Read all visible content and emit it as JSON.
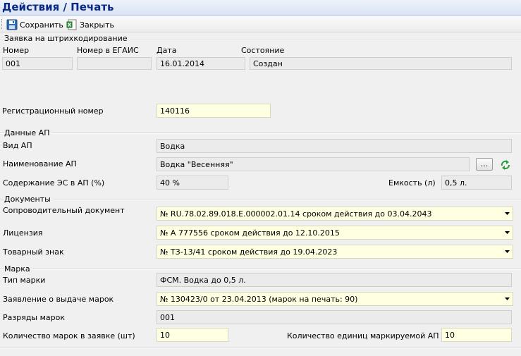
{
  "window": {
    "title": "Действия / Печать"
  },
  "toolbar": {
    "save_label": "Сохранить",
    "close_label": "Закрыть"
  },
  "barcode_request": {
    "section_title": "Заявка на штрихкодирование",
    "number_label": "Номер",
    "number_value": "001",
    "egais_number_label": "Номер в ЕГАИС",
    "egais_number_value": "",
    "date_label": "Дата",
    "date_value": "16.01.2014",
    "status_label": "Состояние",
    "status_value": "Создан",
    "reg_number_label": "Регистрационный номер",
    "reg_number_value": "140116"
  },
  "ap_data": {
    "section_title": "Данные АП",
    "type_label": "Вид АП",
    "type_value": "Водка",
    "name_label": "Наименование АП",
    "name_value": "Водка \"Весенняя\"",
    "browse_label": "...",
    "alcohol_label": "Содержание ЭС в АП (%)",
    "alcohol_value": "40 %",
    "volume_label": "Емкость (л)",
    "volume_value": "0,5 л."
  },
  "documents": {
    "section_title": "Документы",
    "accompanying_label": "Сопроводительный документ",
    "accompanying_value": "№ RU.78.02.89.018.E.000002.01.14 сроком действия до 03.04.2043",
    "license_label": "Лицензия",
    "license_value": "№ А 777556 сроком действия до 12.10.2015",
    "trademark_label": "Товарный знак",
    "trademark_value": "№ ТЗ-13/41 сроком действия до 19.04.2023"
  },
  "stamp": {
    "section_title": "Марка",
    "type_label": "Тип марки",
    "type_value": "ФСМ. Водка до 0,5 л.",
    "application_label": "Заявление о выдаче марок",
    "application_value": "№ 130423/0 от 23.04.2013 (марок на печать: 90)",
    "digits_label": "Разряды марок",
    "digits_value": "001",
    "count_label": "Количество марок в заявке (шт)",
    "count_value": "10",
    "units_label": "Количество единиц маркируемой АП (шт)",
    "units_value": "10"
  }
}
